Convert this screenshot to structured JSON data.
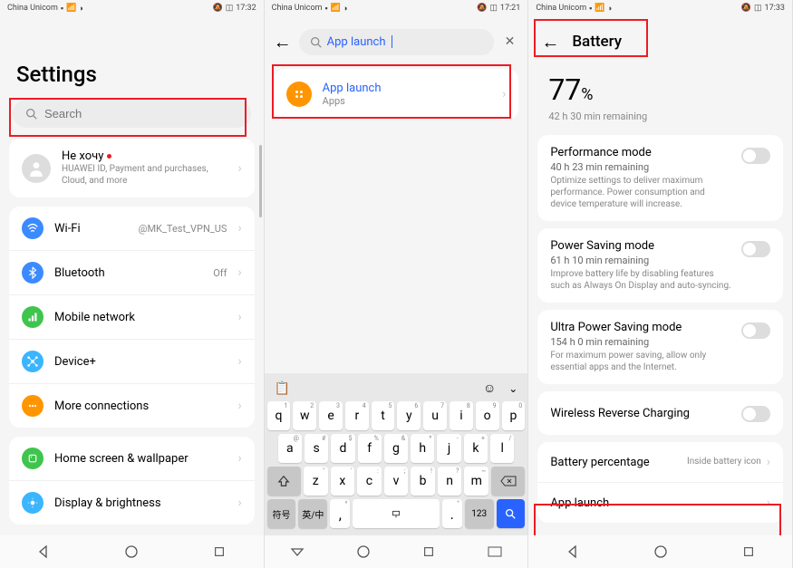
{
  "status": {
    "carrier": "China Unicom",
    "battery_icon": "▢",
    "t1": "17:32",
    "t2": "17:21",
    "t3": "17:33"
  },
  "screen1": {
    "title": "Settings",
    "search_placeholder": "Search",
    "account": {
      "name": "He xoчy",
      "sub": "HUAWEI ID, Payment and purchases, Cloud, and more"
    },
    "items": [
      {
        "label": "Wi-Fi",
        "value": "@MK_Test_VPN_US"
      },
      {
        "label": "Bluetooth",
        "value": "Off"
      },
      {
        "label": "Mobile network",
        "value": ""
      },
      {
        "label": "Device+",
        "value": ""
      },
      {
        "label": "More connections",
        "value": ""
      }
    ],
    "items2": [
      {
        "label": "Home screen & wallpaper"
      },
      {
        "label": "Display & brightness"
      }
    ]
  },
  "screen2": {
    "search_value": "App launch",
    "result": {
      "title": "App launch",
      "sub": "Apps"
    },
    "kb": {
      "row1": [
        "q",
        "w",
        "e",
        "r",
        "t",
        "y",
        "u",
        "i",
        "o",
        "p"
      ],
      "row1_super": [
        "1",
        "2",
        "3",
        "4",
        "5",
        "6",
        "7",
        "8",
        "9",
        "0"
      ],
      "row2": [
        "a",
        "s",
        "d",
        "f",
        "g",
        "h",
        "j",
        "k",
        "l"
      ],
      "row2_super": [
        "@",
        "#",
        "$",
        "%",
        "&",
        "*",
        "-",
        "+",
        "/"
      ],
      "row3": [
        "z",
        "x",
        "c",
        "v",
        "b",
        "n",
        "m"
      ],
      "row3_super": [
        "\"",
        "'",
        ":",
        ";",
        "!",
        "?",
        "~"
      ],
      "fn": "符号",
      "lang": "英/中",
      "num": "123"
    }
  },
  "screen3": {
    "title": "Battery",
    "percent": "77",
    "percent_sym": "%",
    "remaining": "42 h 30 min remaining",
    "modes": [
      {
        "title": "Performance mode",
        "remain": "40 h 23 min remaining",
        "desc": "Optimize settings to deliver maximum performance. Power consumption and device temperature will increase."
      },
      {
        "title": "Power Saving mode",
        "remain": "61 h 10 min remaining",
        "desc": "Improve battery life by disabling features such as Always On Display and auto-syncing."
      },
      {
        "title": "Ultra Power Saving mode",
        "remain": "154 h 0 min remaining",
        "desc": "For maximum power saving, allow only essential apps and the Internet."
      }
    ],
    "wireless": "Wireless Reverse Charging",
    "batt_pct_label": "Battery percentage",
    "batt_pct_value": "Inside battery icon",
    "app_launch": "App launch"
  }
}
